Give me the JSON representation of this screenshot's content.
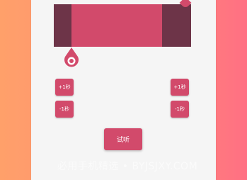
{
  "colors": {
    "accent": "#d24a6b",
    "track": "#6d3448",
    "panel": "#f5f5f5",
    "bg_left": "#ffa06a",
    "bg_right": "#ff7083"
  },
  "trim": {
    "handle_top_icon": "pin-handle-icon",
    "handle_bottom_icon": "ring-pin-handle-icon"
  },
  "controls": {
    "left_plus": "+1秒",
    "left_minus": "-1秒",
    "right_plus": "+1秒",
    "right_minus": "-1秒",
    "preview": "试听"
  },
  "watermark": "必用手机精选 • BYJSJXY.COM"
}
